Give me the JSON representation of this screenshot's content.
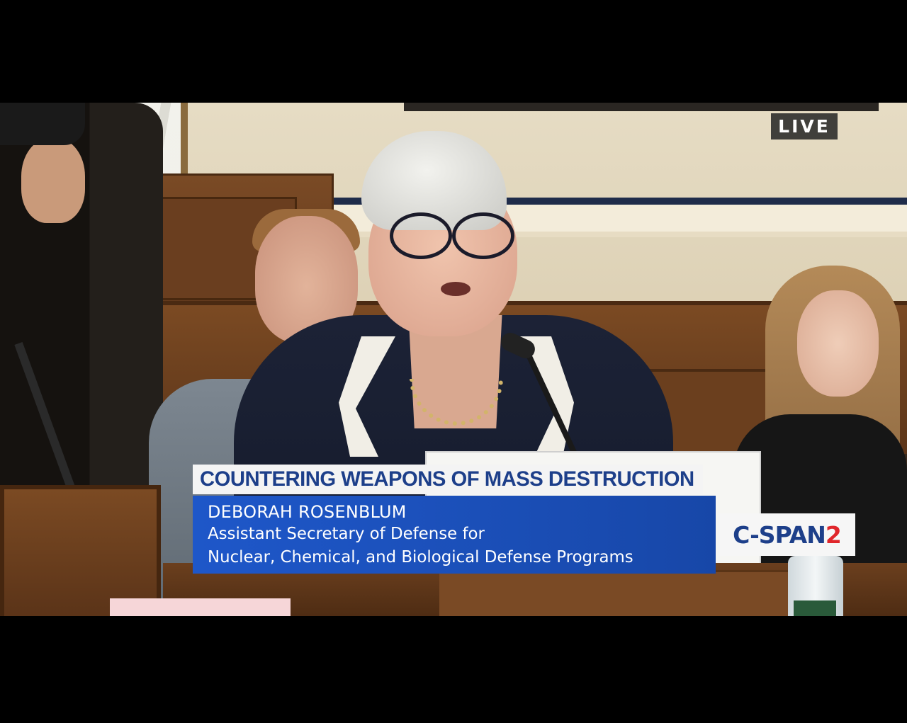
{
  "overlay": {
    "live_label": "LIVE",
    "segment_title": "COUNTERING WEAPONS OF MASS DESTRUCTION",
    "speaker_name": "DEBORAH ROSENBLUM",
    "speaker_title_line1": "Assistant Secretary of Defense for",
    "speaker_title_line2": "Nuclear, Chemical, and Biological Defense Programs"
  },
  "channel": {
    "brand": "C-SPAN",
    "number": "2"
  },
  "colors": {
    "title_text": "#1d3f8a",
    "name_box_bg": "#1e57c9",
    "logo_accent": "#e0262b"
  }
}
